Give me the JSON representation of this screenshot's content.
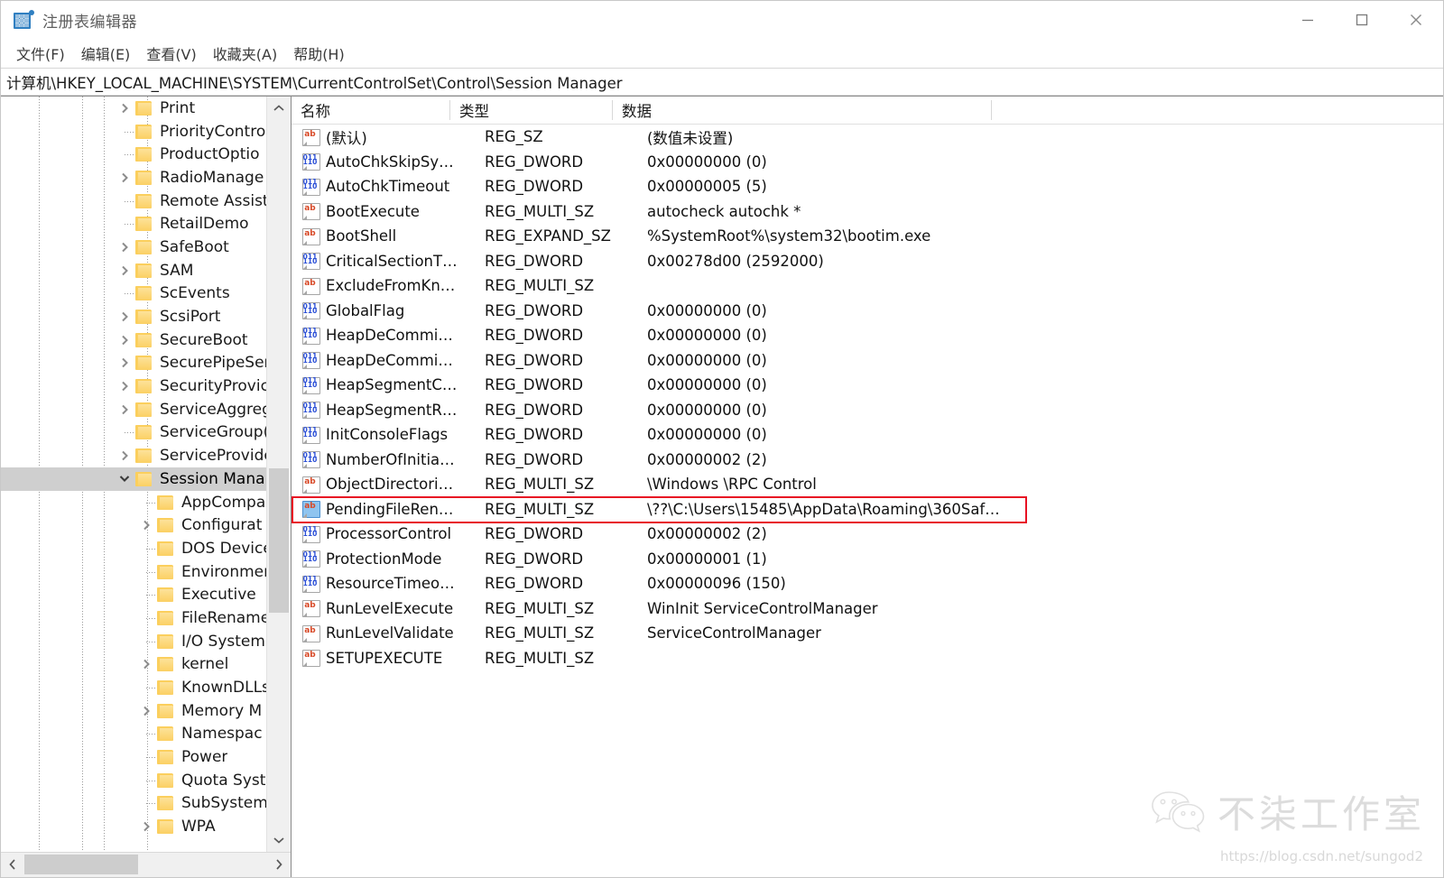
{
  "window": {
    "title": "注册表编辑器",
    "icon": "registry-editor-icon",
    "controls": {
      "minimize": "最小化",
      "maximize": "最大化",
      "close": "关闭"
    }
  },
  "menu": {
    "items": [
      {
        "label": "文件(F)",
        "name": "menu-file"
      },
      {
        "label": "编辑(E)",
        "name": "menu-edit"
      },
      {
        "label": "查看(V)",
        "name": "menu-view"
      },
      {
        "label": "收藏夹(A)",
        "name": "menu-favorites"
      },
      {
        "label": "帮助(H)",
        "name": "menu-help"
      }
    ]
  },
  "address": {
    "path": "计算机\\HKEY_LOCAL_MACHINE\\SYSTEM\\CurrentControlSet\\Control\\Session Manager"
  },
  "tree": {
    "nodes": [
      {
        "label": "Print",
        "depth": 1,
        "twist": "collapsed",
        "selected": false
      },
      {
        "label": "PriorityContro",
        "depth": 1,
        "twist": "leaf",
        "selected": false
      },
      {
        "label": "ProductOptio",
        "depth": 1,
        "twist": "leaf",
        "selected": false
      },
      {
        "label": "RadioManage",
        "depth": 1,
        "twist": "collapsed",
        "selected": false
      },
      {
        "label": "Remote Assist",
        "depth": 1,
        "twist": "leaf",
        "selected": false
      },
      {
        "label": "RetailDemo",
        "depth": 1,
        "twist": "leaf",
        "selected": false
      },
      {
        "label": "SafeBoot",
        "depth": 1,
        "twist": "collapsed",
        "selected": false
      },
      {
        "label": "SAM",
        "depth": 1,
        "twist": "collapsed",
        "selected": false
      },
      {
        "label": "ScEvents",
        "depth": 1,
        "twist": "leaf",
        "selected": false
      },
      {
        "label": "ScsiPort",
        "depth": 1,
        "twist": "collapsed",
        "selected": false
      },
      {
        "label": "SecureBoot",
        "depth": 1,
        "twist": "collapsed",
        "selected": false
      },
      {
        "label": "SecurePipeSer",
        "depth": 1,
        "twist": "collapsed",
        "selected": false
      },
      {
        "label": "SecurityProvic",
        "depth": 1,
        "twist": "collapsed",
        "selected": false
      },
      {
        "label": "ServiceAggreg",
        "depth": 1,
        "twist": "collapsed",
        "selected": false
      },
      {
        "label": "ServiceGroup(",
        "depth": 1,
        "twist": "leaf",
        "selected": false
      },
      {
        "label": "ServiceProvide",
        "depth": 1,
        "twist": "collapsed",
        "selected": false
      },
      {
        "label": "Session Mana",
        "depth": 1,
        "twist": "expanded",
        "selected": true
      },
      {
        "label": "AppCompa",
        "depth": 2,
        "twist": "leaf",
        "selected": false
      },
      {
        "label": "Configurat",
        "depth": 2,
        "twist": "collapsed",
        "selected": false
      },
      {
        "label": "DOS Device",
        "depth": 2,
        "twist": "leaf",
        "selected": false
      },
      {
        "label": "Environmer",
        "depth": 2,
        "twist": "leaf",
        "selected": false
      },
      {
        "label": "Executive",
        "depth": 2,
        "twist": "leaf",
        "selected": false
      },
      {
        "label": "FileRename",
        "depth": 2,
        "twist": "leaf",
        "selected": false
      },
      {
        "label": "I/O System",
        "depth": 2,
        "twist": "leaf",
        "selected": false
      },
      {
        "label": "kernel",
        "depth": 2,
        "twist": "collapsed",
        "selected": false
      },
      {
        "label": "KnownDLLs",
        "depth": 2,
        "twist": "leaf",
        "selected": false
      },
      {
        "label": "Memory M",
        "depth": 2,
        "twist": "collapsed",
        "selected": false
      },
      {
        "label": "Namespac",
        "depth": 2,
        "twist": "leaf",
        "selected": false
      },
      {
        "label": "Power",
        "depth": 2,
        "twist": "leaf",
        "selected": false
      },
      {
        "label": "Quota Syst",
        "depth": 2,
        "twist": "leaf",
        "selected": false
      },
      {
        "label": "SubSystem",
        "depth": 2,
        "twist": "leaf",
        "selected": false
      },
      {
        "label": "WPA",
        "depth": 2,
        "twist": "collapsed",
        "selected": false
      }
    ],
    "scroll": {
      "vertical_up": "向上滚动",
      "vertical_down": "向下滚动",
      "horizontal_left": "向左滚动",
      "horizontal_right": "向右滚动"
    }
  },
  "list": {
    "columns": [
      {
        "label": "名称",
        "name": "column-name"
      },
      {
        "label": "类型",
        "name": "column-type"
      },
      {
        "label": "数据",
        "name": "column-data"
      }
    ],
    "rows": [
      {
        "icon": "string-value-icon",
        "kind": "sz",
        "name": "(默认)",
        "type": "REG_SZ",
        "data": "(数值未设置)",
        "selected": false
      },
      {
        "icon": "dword-value-icon",
        "kind": "dw",
        "name": "AutoChkSkipSy…",
        "type": "REG_DWORD",
        "data": "0x00000000 (0)",
        "selected": false
      },
      {
        "icon": "dword-value-icon",
        "kind": "dw",
        "name": "AutoChkTimeout",
        "type": "REG_DWORD",
        "data": "0x00000005 (5)",
        "selected": false
      },
      {
        "icon": "string-value-icon",
        "kind": "sz",
        "name": "BootExecute",
        "type": "REG_MULTI_SZ",
        "data": "autocheck autochk *",
        "selected": false
      },
      {
        "icon": "string-value-icon",
        "kind": "sz",
        "name": "BootShell",
        "type": "REG_EXPAND_SZ",
        "data": "%SystemRoot%\\system32\\bootim.exe",
        "selected": false
      },
      {
        "icon": "dword-value-icon",
        "kind": "dw",
        "name": "CriticalSectionT…",
        "type": "REG_DWORD",
        "data": "0x00278d00 (2592000)",
        "selected": false
      },
      {
        "icon": "string-value-icon",
        "kind": "sz",
        "name": "ExcludeFromKn…",
        "type": "REG_MULTI_SZ",
        "data": "",
        "selected": false
      },
      {
        "icon": "dword-value-icon",
        "kind": "dw",
        "name": "GlobalFlag",
        "type": "REG_DWORD",
        "data": "0x00000000 (0)",
        "selected": false
      },
      {
        "icon": "dword-value-icon",
        "kind": "dw",
        "name": "HeapDeCommi…",
        "type": "REG_DWORD",
        "data": "0x00000000 (0)",
        "selected": false
      },
      {
        "icon": "dword-value-icon",
        "kind": "dw",
        "name": "HeapDeCommi…",
        "type": "REG_DWORD",
        "data": "0x00000000 (0)",
        "selected": false
      },
      {
        "icon": "dword-value-icon",
        "kind": "dw",
        "name": "HeapSegmentC…",
        "type": "REG_DWORD",
        "data": "0x00000000 (0)",
        "selected": false
      },
      {
        "icon": "dword-value-icon",
        "kind": "dw",
        "name": "HeapSegmentR…",
        "type": "REG_DWORD",
        "data": "0x00000000 (0)",
        "selected": false
      },
      {
        "icon": "dword-value-icon",
        "kind": "dw",
        "name": "InitConsoleFlags",
        "type": "REG_DWORD",
        "data": "0x00000000 (0)",
        "selected": false
      },
      {
        "icon": "dword-value-icon",
        "kind": "dw",
        "name": "NumberOfInitia…",
        "type": "REG_DWORD",
        "data": "0x00000002 (2)",
        "selected": false
      },
      {
        "icon": "string-value-icon",
        "kind": "sz",
        "name": "ObjectDirectori…",
        "type": "REG_MULTI_SZ",
        "data": "\\Windows \\RPC Control",
        "selected": false
      },
      {
        "icon": "string-value-icon",
        "kind": "sz",
        "name": "PendingFileRen…",
        "type": "REG_MULTI_SZ",
        "data": "\\??\\C:\\Users\\15485\\AppData\\Roaming\\360Saf…",
        "selected": true
      },
      {
        "icon": "dword-value-icon",
        "kind": "dw",
        "name": "ProcessorControl",
        "type": "REG_DWORD",
        "data": "0x00000002 (2)",
        "selected": false
      },
      {
        "icon": "dword-value-icon",
        "kind": "dw",
        "name": "ProtectionMode",
        "type": "REG_DWORD",
        "data": "0x00000001 (1)",
        "selected": false
      },
      {
        "icon": "dword-value-icon",
        "kind": "dw",
        "name": "ResourceTimeo…",
        "type": "REG_DWORD",
        "data": "0x00000096 (150)",
        "selected": false
      },
      {
        "icon": "string-value-icon",
        "kind": "sz",
        "name": "RunLevelExecute",
        "type": "REG_MULTI_SZ",
        "data": "WinInit ServiceControlManager",
        "selected": false
      },
      {
        "icon": "string-value-icon",
        "kind": "sz",
        "name": "RunLevelValidate",
        "type": "REG_MULTI_SZ",
        "data": "ServiceControlManager",
        "selected": false
      },
      {
        "icon": "string-value-icon",
        "kind": "sz",
        "name": "SETUPEXECUTE",
        "type": "REG_MULTI_SZ",
        "data": "",
        "selected": false
      }
    ],
    "highlight": {
      "color": "#e81123",
      "target_row": "PendingFileRen…"
    }
  },
  "watermark": {
    "brand": "不柒工作室",
    "logo": "wechat-icon",
    "url": "https://blog.csdn.net/sungod2"
  },
  "colors": {
    "accent": "#2f7fc1",
    "highlight_red": "#e81123",
    "selection_gray": "#cfcfcf",
    "folder_yellow": "#fbcf5d"
  }
}
